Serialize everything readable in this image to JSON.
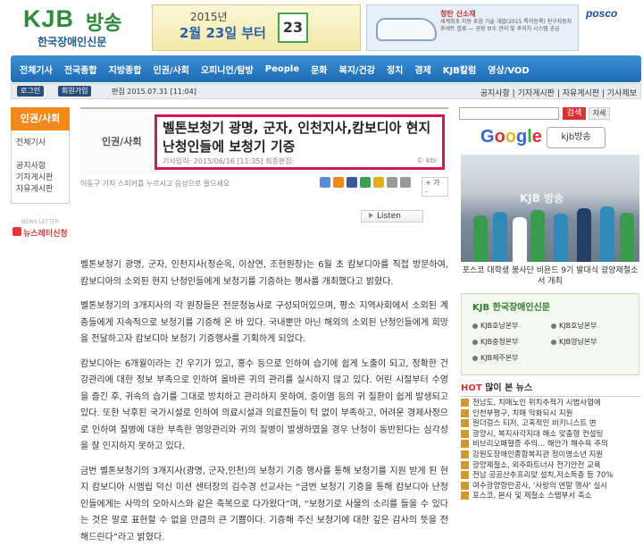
{
  "header": {
    "logo_kjb": "KJB",
    "logo_broadcast": "방송",
    "logo_sub": "한국장애인신문",
    "ad1_year": "2015년",
    "ad1_date": "2월 23일 부터",
    "ad1_cal": "23",
    "ad2_title": "청탄 신소재",
    "ad2_text": "세계최초 자동 초음 기술 개발(2015 특허등록) 친구자동차 후세트 합류 — 공장 보수 관리 및 후의치 시스템 공급",
    "posco": "posco"
  },
  "nav": {
    "items": [
      "전체기사",
      "전국종합",
      "지방종합",
      "인권/사회",
      "오피니언/탐방",
      "People",
      "문화",
      "복지/건강",
      "정치",
      "경제",
      "KJB칼럼",
      "영상/VOD"
    ]
  },
  "subbar": {
    "login": "로그인",
    "join": "회원가입",
    "edit_stamp": "편집 2015.07.31 [11:04]",
    "links": "공지사항 | 기자게시판 | 자유게시판 | 기사제보"
  },
  "left": {
    "header": "인권/사회",
    "menu": [
      "전체기사",
      "",
      "공지사항",
      "기자게시판",
      "자유게시판"
    ],
    "newsletter_top": "NEWS LETTER",
    "newsletter": "뉴스레터신청"
  },
  "article": {
    "category": "인권/사회",
    "title": "벨톤보청기 광명, 군자, 인천지사,캄보디아 현지 난청인들에 보청기 기증",
    "meta": "기사입력: 2015/06/16 [11:35]  최종편집:",
    "meta_right": "© kbi",
    "tts_note": "이동구 가지 스피커를 누르시고 음성으로 들으세요",
    "font_ctl": "+ 가 -",
    "listen": "Listen",
    "paragraphs": [
      "벨톤보청기 광명, 군자, 인천지사(정순옥, 이상연, 조현원장)는 6월 초 캄보디아를 직접 방문하여, 캄보디아의 소외된 현지 난청인들에게 보청기를 기증하는 행사를 개최했다고 밝혔다.",
      "벨톤보청기의 3개지사의 각 원장들은 전문청능사로 구성되어있으며, 평소 지역사회에서 소외된 계층들에게 지속적으로 보청기를 기증해 온 바 있다. 국내뿐만 아닌 해외의 소외된 난청인들에게 희망을 전달하고자 캄보디아 보청기 기증행사를 기획하게 되었다.",
      "캄보디아는 6개월이라는 긴 우기가 있고, 홍수 등으로 인하여 습기에 쉽게 노출이 되고, 정확한 건강관리에 대한 정보 부족으로 인하여 올바른 귀의 관리를 실시하지 않고 있다. 어린 시절부터 수영을 즐긴 후, 귀속의 습기를 그대로 방치하고 관리하지 못하여, 중이염 등의 귀 질환이 쉽게 발생되고 있다. 또한 낙후된 국가시설로 인하여 의료시설과 의료진들이 턱 없이 부족하고, 어려운 경제사정으로 인하여 질병에 대한 부족한 영양관리와 귀의 질병이 발생하였을 경우 난청이 동반된다는 심각성을 잘 인지하지 못하고 있다.",
      "금번 벨톤보청기의 3개지사(광명, 군자,인천)의 보청기 기증 행사를 통해 보청기를 지원 받게 된 현지 캄보디아 시엠립 덕신 미션 센터장의 김수경 선교사는 “금번 보청기 기증을 통해 캄보디아 난청인들에게는 사막의 오아시스와 같은 축복으로 다가왔다”며, “보청기로 사물의 소리를 들을 수 있다는 것은 말로 표현할 수 없을 만큼의 큰 기쁨이다. 기증해 주신 보청기에 대한 깊은 감사의 뜻을 전해드린다”라고 밝혔다."
    ]
  },
  "right": {
    "search_btn": "검색",
    "detail_btn": "자세",
    "google": "Google",
    "kjb_btn": "kjb방송",
    "photo_label": "KJB 방송",
    "caption": "포스코 대학생 봉사단 비욘드 9기 발대식 광양제철소서 개최",
    "hq_logo": "KJB 한국장애인신문",
    "hq": [
      "KJB호남본부",
      "KJB충청본부",
      "KJB영남본부",
      "KJB제주본부"
    ],
    "hq_right": [
      "KJB호남본부",
      "KJB영남본부"
    ],
    "hot_prefix": "HOT",
    "hot_title": "많이 본 뉴스",
    "hot_items": [
      "전남도, 치매노인 위치추적기 시범사업에",
      "인천부평구, 치매 악화되시 지원",
      "원더걸스 티저, 고혹적인 비키니스트 변",
      "광양시, 복지사각지대 해소 맞춤형 컨설팅",
      "비브리오패혈증 주의... 해안가 해수욕 주의",
      "강원도장애인종합복지관 정이영소년 지원",
      "광양제철소, 외주파트너사 전기안전 교육",
      "전남 공공산추프리맞 설치,저소득층 등 70%",
      "여수광양항만공사, '사랑의 연말 행사' 실시",
      "포스코, 본사 및 제철소 스탭부서 축소"
    ]
  }
}
